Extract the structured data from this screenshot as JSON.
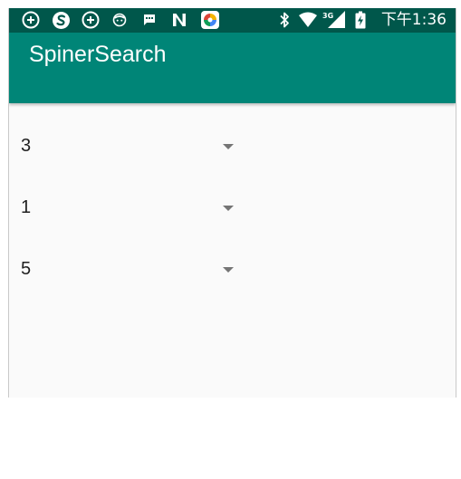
{
  "status_bar": {
    "time": "下午1:36",
    "network": "3G",
    "left_icons": [
      "plus-circle-icon",
      "sogou-s-icon",
      "plus-circle-icon",
      "face-icon",
      "message-icon",
      "n-icon",
      "colorful-app-icon"
    ],
    "right_icons": [
      "bluetooth-icon",
      "wifi-icon",
      "cell-signal-icon",
      "battery-charging-icon"
    ],
    "colors": {
      "background": "#00574b",
      "foreground": "#ffffff"
    }
  },
  "app_bar": {
    "title": "SpinerSearch",
    "color": "#008577"
  },
  "spinners": [
    {
      "value": "3"
    },
    {
      "value": "1"
    },
    {
      "value": "5"
    }
  ]
}
